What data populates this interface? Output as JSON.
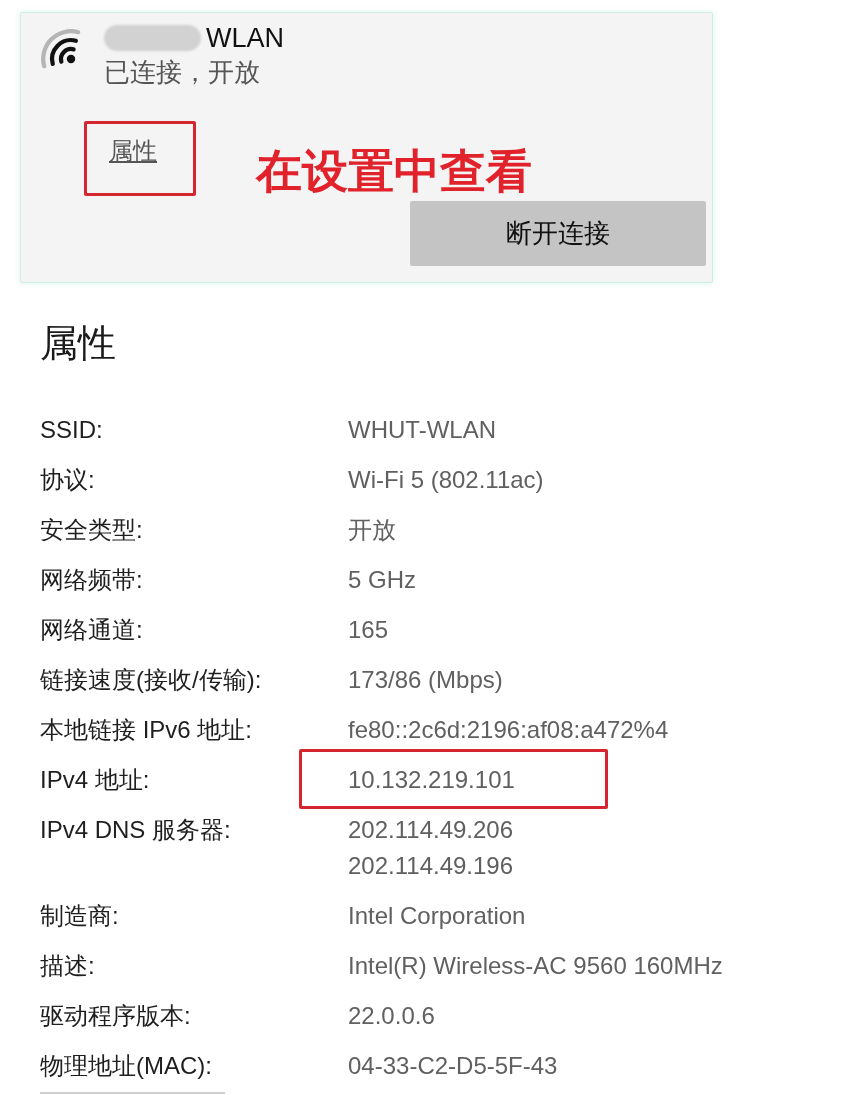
{
  "network_card": {
    "name_redacted": true,
    "name": "WLAN",
    "status": "已连接，开放",
    "properties_link": {
      "label": "属性",
      "highlighted": true
    },
    "annotation": "在设置中查看",
    "disconnect_button": "断开连接"
  },
  "properties": {
    "title": "属性",
    "rows": [
      {
        "label": "SSID:",
        "values": [
          "WHUT-WLAN"
        ],
        "highlighted": false
      },
      {
        "label": "协议:",
        "values": [
          "Wi-Fi 5 (802.11ac)"
        ],
        "highlighted": false
      },
      {
        "label": "安全类型:",
        "values": [
          "开放"
        ],
        "highlighted": false
      },
      {
        "label": "网络频带:",
        "values": [
          "5 GHz"
        ],
        "highlighted": false
      },
      {
        "label": "网络通道:",
        "values": [
          "165"
        ],
        "highlighted": false
      },
      {
        "label": "链接速度(接收/传输):",
        "values": [
          "173/86 (Mbps)"
        ],
        "highlighted": false
      },
      {
        "label": "本地链接 IPv6 地址:",
        "values": [
          "fe80::2c6d:2196:af08:a472%4"
        ],
        "highlighted": false
      },
      {
        "label": "IPv4 地址:",
        "values": [
          "10.132.219.101"
        ],
        "highlighted": true
      },
      {
        "label": "IPv4 DNS 服务器:",
        "values": [
          "202.114.49.206",
          "202.114.49.196"
        ],
        "highlighted": false
      },
      {
        "label": "制造商:",
        "values": [
          "Intel Corporation"
        ],
        "highlighted": false
      },
      {
        "label": "描述:",
        "values": [
          "Intel(R) Wireless-AC 9560 160MHz"
        ],
        "highlighted": false
      },
      {
        "label": "驱动程序版本:",
        "values": [
          "22.0.0.6"
        ],
        "highlighted": false
      },
      {
        "label": "物理地址(MAC):",
        "values": [
          "04-33-C2-D5-5F-43"
        ],
        "highlighted": false
      }
    ]
  }
}
